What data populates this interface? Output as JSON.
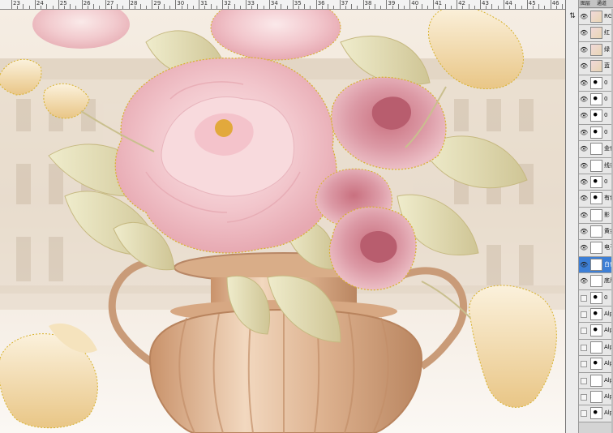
{
  "ruler": {
    "labels": [
      "23",
      "24",
      "25",
      "26",
      "27",
      "28",
      "29",
      "30",
      "31",
      "32",
      "33",
      "34",
      "35",
      "36",
      "37",
      "38",
      "39",
      "40",
      "41",
      "42",
      "43",
      "44",
      "45",
      "46"
    ]
  },
  "canvas": {
    "artwork": "peony-rose-vase-illustration",
    "colors": {
      "peony": "#f2c7cd",
      "rose": "#d98e9b",
      "leaf": "#ddd7ac",
      "tulip": "#f1d9a4",
      "vase": "#d6a47e",
      "building": "#d8cab6",
      "selection": "#d8b12a"
    }
  },
  "panel": {
    "tabs": [
      "图层",
      "通道"
    ],
    "tool_glyph": "⇅",
    "layers": [
      {
        "name": "RGB",
        "visible": true,
        "thumb": "img",
        "selected": false
      },
      {
        "name": "红",
        "visible": true,
        "thumb": "img",
        "selected": false
      },
      {
        "name": "绿",
        "visible": true,
        "thumb": "img",
        "selected": false
      },
      {
        "name": "蓝",
        "visible": true,
        "thumb": "img",
        "selected": false
      },
      {
        "name": "0",
        "visible": true,
        "thumb": "dark",
        "selected": false
      },
      {
        "name": "0",
        "visible": true,
        "thumb": "dark",
        "selected": false
      },
      {
        "name": "0",
        "visible": true,
        "thumb": "dark",
        "selected": false
      },
      {
        "name": "0",
        "visible": true,
        "thumb": "dark",
        "selected": false
      },
      {
        "name": "金色",
        "visible": true,
        "thumb": "plain",
        "selected": false
      },
      {
        "name": "线条",
        "visible": true,
        "thumb": "plain",
        "selected": false
      },
      {
        "name": "0",
        "visible": true,
        "thumb": "dark",
        "selected": false
      },
      {
        "name": "有色",
        "visible": true,
        "thumb": "dark",
        "selected": false
      },
      {
        "name": "影",
        "visible": true,
        "thumb": "plain",
        "selected": false
      },
      {
        "name": "黄金",
        "visible": true,
        "thumb": "plain",
        "selected": false
      },
      {
        "name": "电子",
        "visible": true,
        "thumb": "plain",
        "selected": false
      },
      {
        "name": "白色",
        "visible": true,
        "thumb": "plain",
        "selected": true
      },
      {
        "name": "底层",
        "visible": true,
        "thumb": "plain",
        "selected": false
      },
      {
        "name": "0",
        "visible": false,
        "thumb": "dark",
        "selected": false
      },
      {
        "name": "Alpha",
        "visible": false,
        "thumb": "dark",
        "selected": false
      },
      {
        "name": "Alpha",
        "visible": false,
        "thumb": "dark",
        "selected": false
      },
      {
        "name": "Alpha",
        "visible": false,
        "thumb": "plain",
        "selected": false
      },
      {
        "name": "Alpha",
        "visible": false,
        "thumb": "dark",
        "selected": false
      },
      {
        "name": "Alpha",
        "visible": false,
        "thumb": "plain",
        "selected": false
      },
      {
        "name": "Alpha",
        "visible": false,
        "thumb": "plain",
        "selected": false
      },
      {
        "name": "Alpha",
        "visible": false,
        "thumb": "dark",
        "selected": false
      }
    ]
  }
}
